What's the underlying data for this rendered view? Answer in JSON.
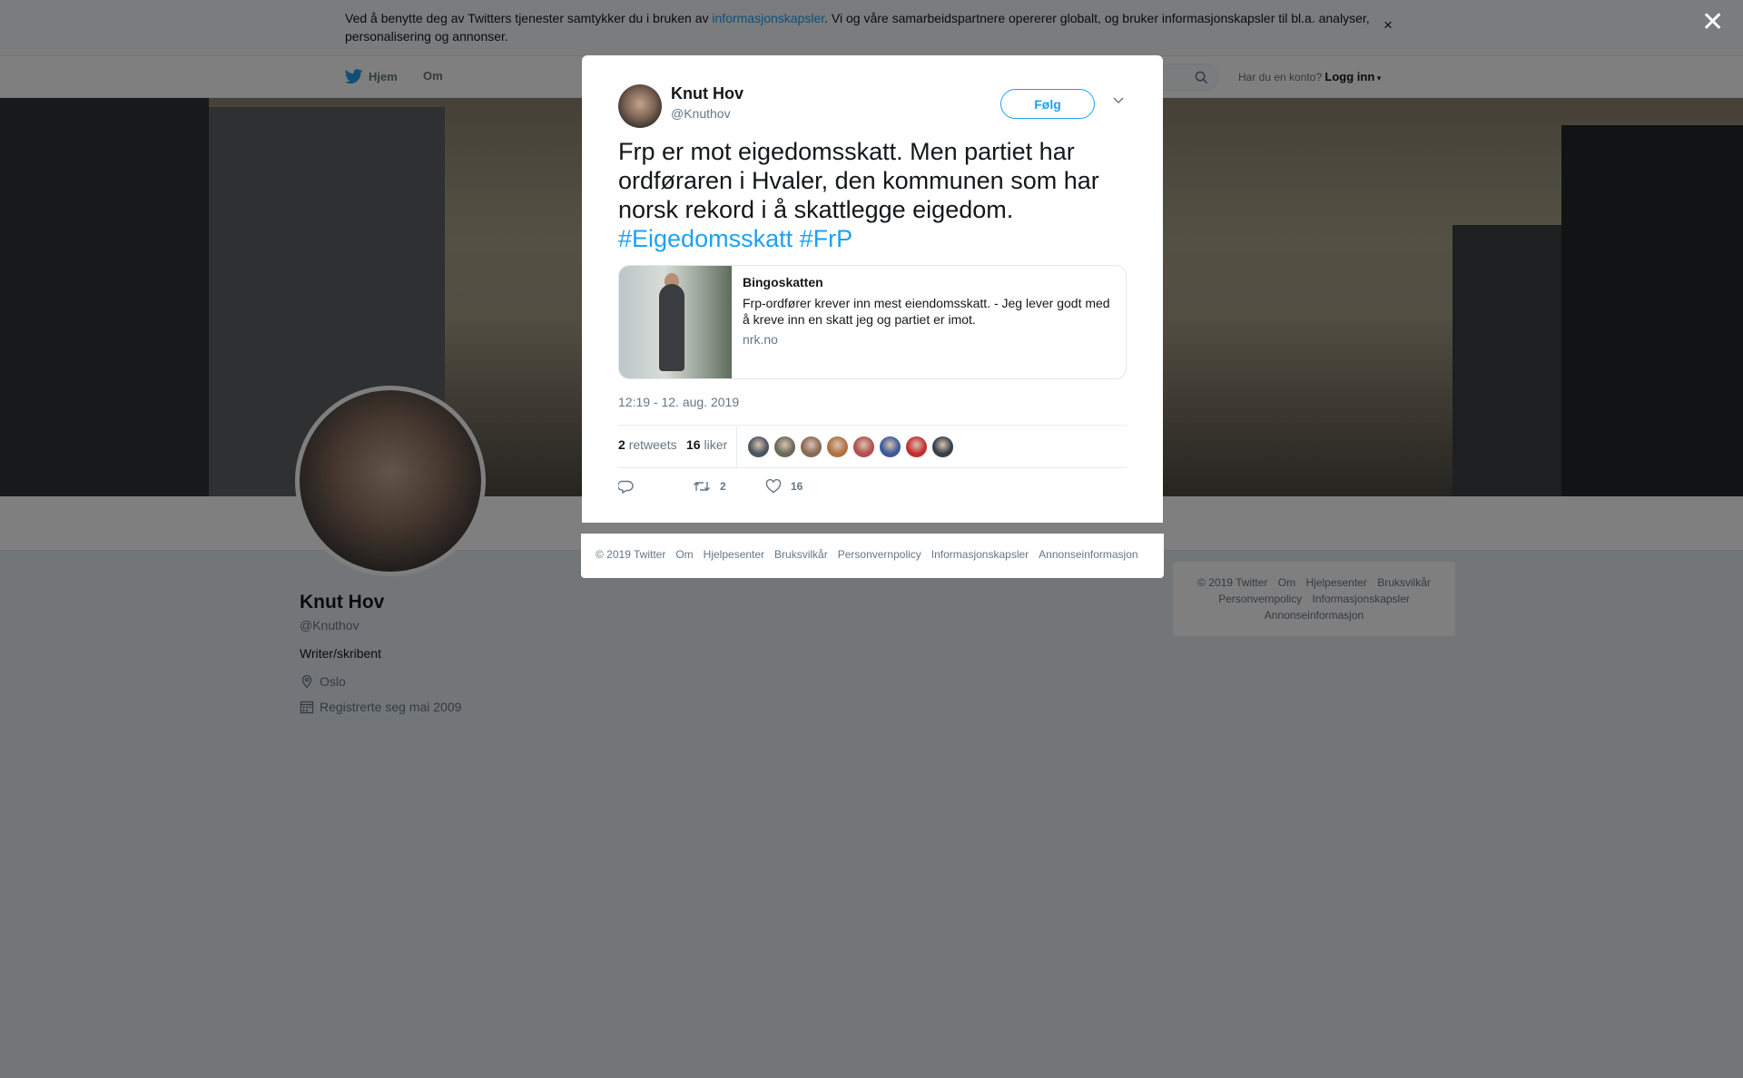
{
  "cookie_banner": {
    "text_before": "Ved å benytte deg av Twitters tjenester samtykker du i bruken av ",
    "link": "informasjonskapsler",
    "text_after": ". Vi og våre samarbeidspartnere opererer globalt, og bruker informasjonskapsler til bl.a. analyser, personalisering og annonser.",
    "close": "×"
  },
  "nav": {
    "home": "Hjem",
    "about": "Om",
    "account_prompt": "Har du en konto?",
    "login": "Logg inn"
  },
  "profile": {
    "name": "Knut Hov",
    "handle": "@Knuthov",
    "bio": "Writer/skribent",
    "location": "Oslo",
    "joined": "Registrerte seg mai 2009"
  },
  "side_footer": {
    "links": [
      "© 2019 Twitter",
      "Om",
      "Hjelpesenter",
      "Bruksvilkår",
      "Personvernpolicy",
      "Informasjonskapsler",
      "Annonseinformasjon"
    ]
  },
  "overlay": {
    "close": "✕"
  },
  "tweet": {
    "author_name": "Knut Hov",
    "author_handle": "@Knuthov",
    "follow": "Følg",
    "text": "Frp er mot eigedomsskatt. Men partiet har ordføraren i Hvaler, den kommunen som har norsk rekord i å skattlegge eigedom.",
    "hashtags": [
      "#Eigedomsskatt",
      "#FrP"
    ],
    "card": {
      "title": "Bingoskatten",
      "description": "Frp-ordfører krever inn mest eiendomsskatt. - Jeg lever godt med å kreve inn en skatt jeg og partiet er imot.",
      "domain": "nrk.no"
    },
    "timestamp": "12:19 - 12. aug. 2019",
    "retweets_count": "2",
    "retweets_label": "retweets",
    "likes_count": "16",
    "likes_label": "liker",
    "liker_colors": [
      "#4a5560",
      "#6a6a5a",
      "#8a6a55",
      "#b07040",
      "#b05050",
      "#3a5a9a",
      "#c03030",
      "#354048"
    ],
    "action_retweet_count": "2",
    "action_like_count": "16"
  },
  "modal_footer": {
    "links": [
      "© 2019 Twitter",
      "Om",
      "Hjelpesenter",
      "Bruksvilkår",
      "Personvernpolicy",
      "Informasjonskapsler",
      "Annonseinformasjon"
    ]
  }
}
